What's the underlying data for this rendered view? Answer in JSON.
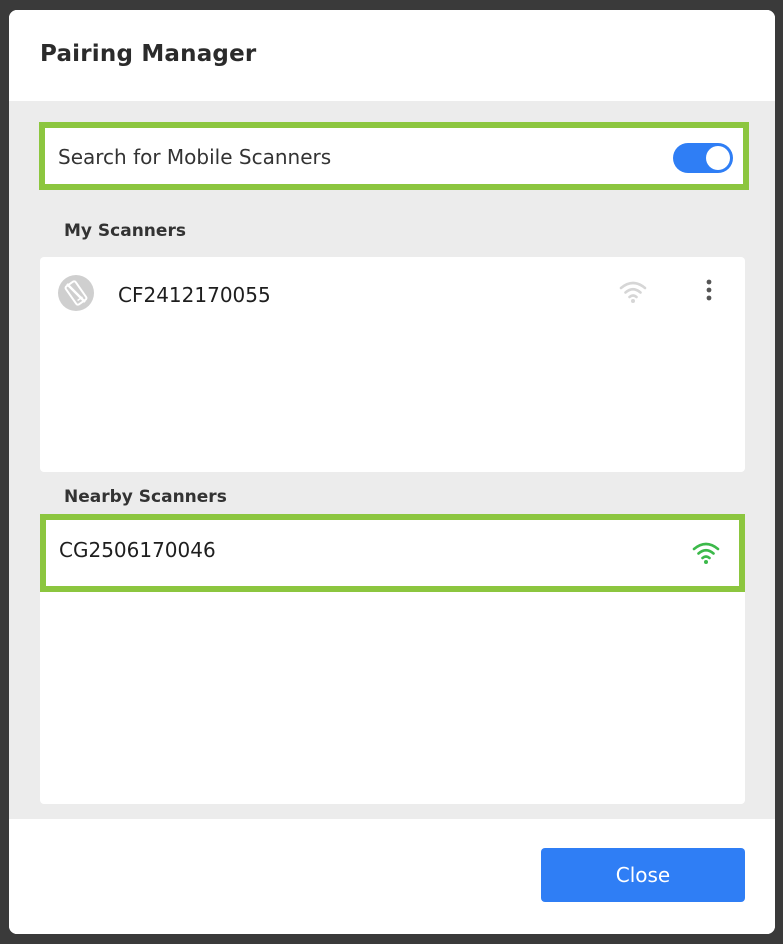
{
  "dialog": {
    "title": "Pairing Manager"
  },
  "search": {
    "label": "Search for Mobile Scanners",
    "toggle_on": true
  },
  "my_scanners": {
    "heading": "My Scanners",
    "items": [
      {
        "name": "CF2412170055",
        "icon": "phone-disconnected-icon",
        "signal": "wifi-icon-inactive"
      }
    ]
  },
  "nearby_scanners": {
    "heading": "Nearby Scanners",
    "items": [
      {
        "name": "CG2506170046",
        "signal": "wifi-icon-active"
      }
    ]
  },
  "footer": {
    "close_label": "Close"
  },
  "colors": {
    "accent": "#2f7ef5",
    "highlight": "#8cc63f",
    "wifi_active": "#3cb94a",
    "wifi_inactive": "#d6d6d6"
  }
}
